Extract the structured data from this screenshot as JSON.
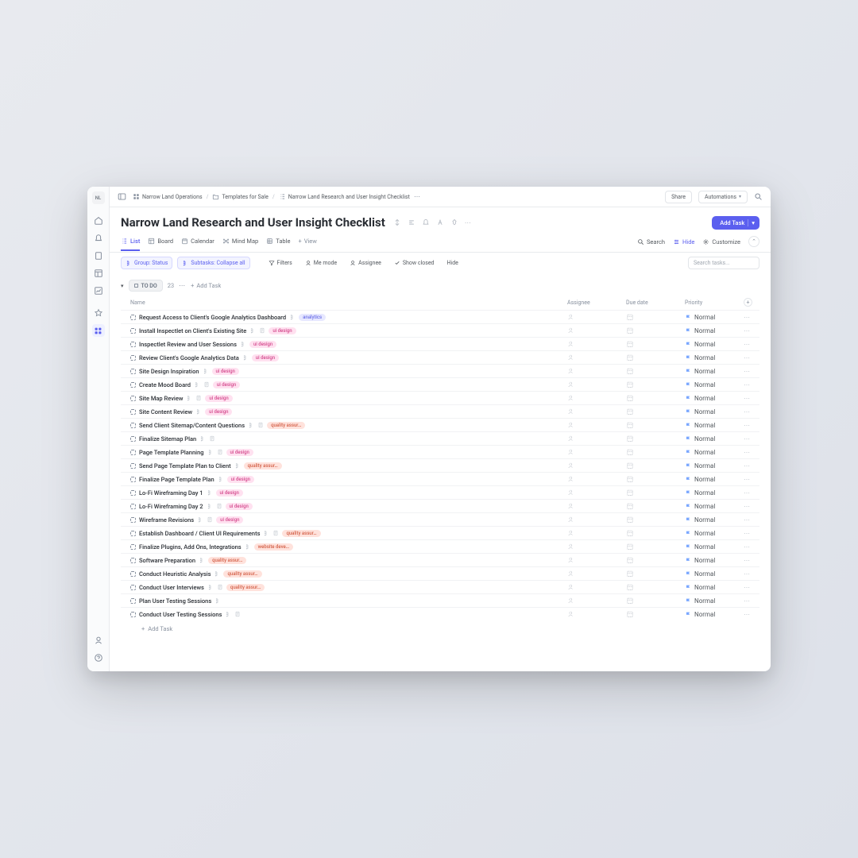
{
  "workspace_avatar": "NL",
  "breadcrumbs": {
    "root": "Narrow Land Operations",
    "folder": "Templates for Sale",
    "list": "Narrow Land Research and User Insight Checklist"
  },
  "topbar": {
    "share": "Share",
    "automations": "Automations"
  },
  "header_title": "Narrow Land Research and User Insight Checklist",
  "add_task": "Add Task",
  "views": {
    "list": "List",
    "board": "Board",
    "calendar": "Calendar",
    "mindmap": "Mind Map",
    "table": "Table",
    "add": "View"
  },
  "view_actions": {
    "search": "Search",
    "hide": "Hide",
    "customize": "Customize"
  },
  "filters": {
    "group": "Group: Status",
    "subtasks": "Subtasks: Collapse all",
    "filters": "Filters",
    "me": "Me mode",
    "assignee": "Assignee",
    "closed": "Show closed",
    "hide": "Hide",
    "search_placeholder": "Search tasks..."
  },
  "group": {
    "status": "TO DO",
    "count": "23",
    "add": "Add Task"
  },
  "columns": {
    "name": "Name",
    "assignee": "Assignee",
    "due": "Due date",
    "priority": "Priority"
  },
  "priority_label": "Normal",
  "add_row": "Add Task",
  "tasks": [
    {
      "name": "Request Access to Client's Google Analytics Dashboard",
      "sub": true,
      "tags": [
        [
          "analytics",
          "analytics"
        ]
      ]
    },
    {
      "name": "Install Inspectlet on Client's Existing Site",
      "sub": true,
      "doc": true,
      "tags": [
        [
          "ui design",
          "uidesign"
        ]
      ]
    },
    {
      "name": "Inspectlet Review and User Sessions",
      "sub": true,
      "tags": [
        [
          "ui design",
          "uidesign"
        ]
      ]
    },
    {
      "name": "Review Client's Google Analytics Data",
      "sub": true,
      "tags": [
        [
          "ui design",
          "uidesign"
        ]
      ]
    },
    {
      "name": "Site Design Inspiration",
      "sub": true,
      "tags": [
        [
          "ui design",
          "uidesign"
        ]
      ]
    },
    {
      "name": "Create Mood Board",
      "sub": true,
      "doc": true,
      "tags": [
        [
          "ui design",
          "uidesign"
        ]
      ]
    },
    {
      "name": "Site Map Review",
      "sub": true,
      "doc": true,
      "tags": [
        [
          "ui design",
          "uidesign"
        ]
      ]
    },
    {
      "name": "Site Content Review",
      "sub": true,
      "tags": [
        [
          "ui design",
          "uidesign"
        ]
      ]
    },
    {
      "name": "Send Client Sitemap/Content Questions",
      "sub": true,
      "doc": true,
      "tags": [
        [
          "quality assur…",
          "qa"
        ]
      ]
    },
    {
      "name": "Finalize Sitemap Plan",
      "sub": true,
      "doc": true,
      "tags": []
    },
    {
      "name": "Page Template Planning",
      "sub": true,
      "doc": true,
      "tags": [
        [
          "ui design",
          "uidesign"
        ]
      ]
    },
    {
      "name": "Send Page Template Plan to Client",
      "sub": true,
      "tags": [
        [
          "quality assur…",
          "qa"
        ]
      ]
    },
    {
      "name": "Finalize Page Template Plan",
      "sub": true,
      "tags": [
        [
          "ui design",
          "uidesign"
        ]
      ]
    },
    {
      "name": "Lo-Fi Wireframing Day 1",
      "sub": true,
      "tags": [
        [
          "ui design",
          "uidesign"
        ]
      ]
    },
    {
      "name": "Lo-Fi Wireframing Day 2",
      "sub": true,
      "doc": true,
      "tags": [
        [
          "ui design",
          "uidesign"
        ]
      ]
    },
    {
      "name": "Wireframe Revisions",
      "sub": true,
      "doc": true,
      "tags": [
        [
          "ui design",
          "uidesign"
        ]
      ]
    },
    {
      "name": "Establish Dashboard / Client UI Requirements",
      "sub": true,
      "doc": true,
      "tags": [
        [
          "quality assur…",
          "qa"
        ]
      ]
    },
    {
      "name": "Finalize Plugins, Add Ons, Integrations",
      "sub": true,
      "tags": [
        [
          "website deve…",
          "webdev"
        ]
      ]
    },
    {
      "name": "Software Preparation",
      "sub": true,
      "tags": [
        [
          "quality assur…",
          "qa"
        ]
      ]
    },
    {
      "name": "Conduct Heuristic Analysis",
      "sub": true,
      "tags": [
        [
          "quality assur…",
          "qa"
        ]
      ]
    },
    {
      "name": "Conduct User Interviews",
      "sub": true,
      "doc": true,
      "tags": [
        [
          "quality assur…",
          "qa"
        ]
      ]
    },
    {
      "name": "Plan User Testing Sessions",
      "sub": true,
      "tags": []
    },
    {
      "name": "Conduct User Testing Sessions",
      "sub": true,
      "doc": true,
      "tags": []
    }
  ]
}
